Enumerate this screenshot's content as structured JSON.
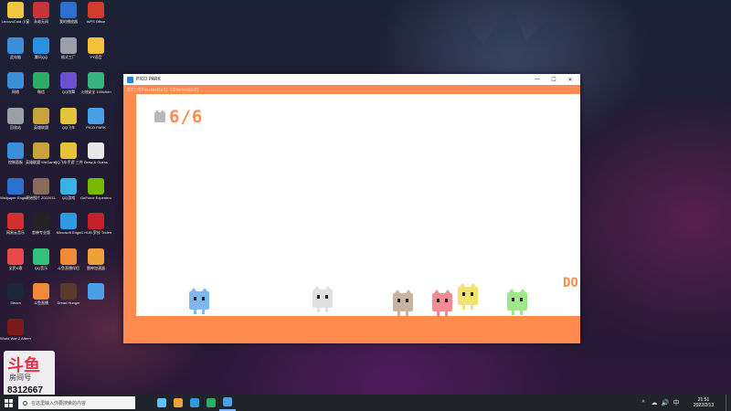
{
  "window": {
    "title": "PICO PARK",
    "hud_info": "ST1:0Fwrlnd(e1) 1Sbrlnd(e2)",
    "controls": {
      "minimize": "—",
      "maximize": "☐",
      "close": "✕"
    }
  },
  "game": {
    "counter": "6/6",
    "door_text": "DO",
    "players": [
      {
        "color": "#7fb7f0"
      },
      {
        "color": "#e0e0e0"
      },
      {
        "color": "#c9b3a3"
      },
      {
        "color": "#f28b93"
      },
      {
        "color": "#f2e36b"
      },
      {
        "color": "#9fe889"
      }
    ]
  },
  "desktop": {
    "icons": [
      {
        "label": "LenovoCold 小窗",
        "icon": "folder-icon",
        "color": "#f4c542"
      },
      {
        "label": "永劫无间",
        "icon": "game-icon",
        "color": "#c8343a"
      },
      {
        "label": "我的播放器",
        "icon": "media-icon",
        "color": "#2d6fcf"
      },
      {
        "label": "WPS Office",
        "icon": "wps-icon",
        "color": "#d33d2b"
      },
      {
        "label": "此电脑",
        "icon": "computer-icon",
        "color": "#3a8fd8"
      },
      {
        "label": "腾讯QQ",
        "icon": "qq-icon",
        "color": "#2d8fe0"
      },
      {
        "label": "格式工厂",
        "icon": "factory-icon",
        "color": "#9aa0a8"
      },
      {
        "label": "YY语音",
        "icon": "yy-icon",
        "color": "#f4c13a"
      },
      {
        "label": "网络",
        "icon": "network-icon",
        "color": "#3a8fd8"
      },
      {
        "label": "微信",
        "icon": "wechat-icon",
        "color": "#2aae67"
      },
      {
        "label": "QQ炫舞",
        "icon": "dance-icon",
        "color": "#6a4fcf"
      },
      {
        "label": "火绒安全 100ichen",
        "icon": "shield-icon",
        "color": "#36b37e"
      },
      {
        "label": "回收站",
        "icon": "recycle-bin-icon",
        "color": "#9aa0a8"
      },
      {
        "label": "英雄联盟",
        "icon": "lol-icon",
        "color": "#c8a23a"
      },
      {
        "label": "QQ飞车",
        "icon": "race-icon",
        "color": "#e6c43a"
      },
      {
        "label": "PICO PARK",
        "icon": "pico-park-icon",
        "color": "#4aa0e8"
      },
      {
        "label": "控制面板",
        "icon": "control-panel-icon",
        "color": "#3a8fd8"
      },
      {
        "label": "英雄联盟 WeGame版",
        "icon": "lol-icon",
        "color": "#c8a23a"
      },
      {
        "label": "QQ飞车手游 三件",
        "icon": "race-icon",
        "color": "#e6c43a"
      },
      {
        "label": "Draw & Guess",
        "icon": "draw-icon",
        "color": "#e8e8e8"
      },
      {
        "label": "Wallpaper Engine : 壁纸",
        "icon": "wallpaper-icon",
        "color": "#2d6fcf"
      },
      {
        "label": "原始图片 2022011...",
        "icon": "image-icon",
        "color": "#8a6a5a"
      },
      {
        "label": "QQ游戏",
        "icon": "qq-game-icon",
        "color": "#3ab0e8"
      },
      {
        "label": "GeForce Experience",
        "icon": "nvidia-icon",
        "color": "#76b900"
      },
      {
        "label": "网易云音乐",
        "icon": "music-icon",
        "color": "#d3302f"
      },
      {
        "label": "剪映专业版",
        "icon": "capcut-icon",
        "color": "#222222"
      },
      {
        "label": "Microsoft Edge",
        "icon": "edge-icon",
        "color": "#2f9ae0"
      },
      {
        "label": "G HUB 罗技 Trident",
        "icon": "ghub-icon",
        "color": "#c8202a"
      },
      {
        "label": "全民K歌",
        "icon": "karaoke-icon",
        "color": "#e84a4a"
      },
      {
        "label": "QQ音乐",
        "icon": "qq-music-icon",
        "color": "#31c27c"
      },
      {
        "label": "斗鱼直播伴侣",
        "icon": "douyu-icon",
        "color": "#f08a3a"
      },
      {
        "label": "雷神加速器",
        "icon": "accelerator-icon",
        "color": "#f0a03a"
      },
      {
        "label": "Steam",
        "icon": "steam-icon",
        "color": "#1b2838"
      },
      {
        "label": "斗鱼直播",
        "icon": "douyu-icon",
        "color": "#f08a3a"
      },
      {
        "label": "Dread Hunger",
        "icon": "dread-hunger-icon",
        "color": "#5a3a2a"
      },
      {
        "label": "",
        "icon": "app-icon",
        "color": "#4aa0e8"
      },
      {
        "label": "World War Z Aftermath",
        "icon": "wwz-icon",
        "color": "#7a1a1a"
      }
    ]
  },
  "watermark": {
    "logo": "斗鱼",
    "label": "房间号",
    "number": "8312667"
  },
  "taskbar": {
    "search_placeholder": "在这里输入你要搜索的内容",
    "apps": [
      {
        "icon": "steam-icon",
        "color": "#66c0f4"
      },
      {
        "icon": "store-icon",
        "color": "#f0a03a"
      },
      {
        "icon": "edge-icon",
        "color": "#2f9ae0"
      },
      {
        "icon": "wechat-icon",
        "color": "#2aae67"
      },
      {
        "icon": "pico-park-icon",
        "color": "#4aa0e8"
      }
    ],
    "tray_icons": [
      "^",
      "☁",
      "🔊",
      "中"
    ],
    "time": "21:51",
    "date": "2022/2/13"
  }
}
